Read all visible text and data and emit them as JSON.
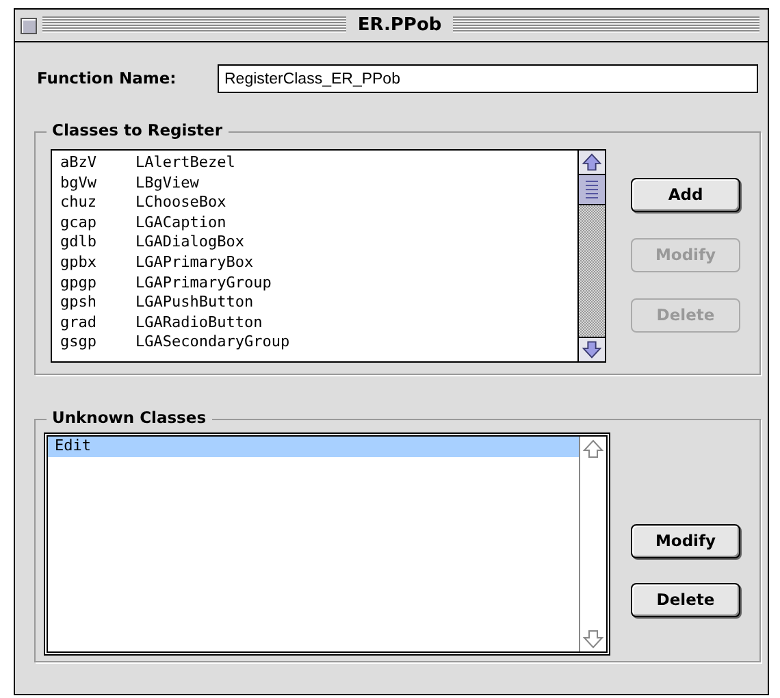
{
  "window": {
    "title": "ER.PPob"
  },
  "function_name": {
    "label": "Function Name:",
    "value": "RegisterClass_ER_PPob"
  },
  "classes_to_register": {
    "title": "Classes to Register",
    "rows": [
      {
        "code": "aBzV",
        "name": "LAlertBezel"
      },
      {
        "code": "bgVw",
        "name": "LBgView"
      },
      {
        "code": "chuz",
        "name": "LChooseBox"
      },
      {
        "code": "gcap",
        "name": "LGACaption"
      },
      {
        "code": "gdlb",
        "name": "LGADialogBox"
      },
      {
        "code": "gpbx",
        "name": "LGAPrimaryBox"
      },
      {
        "code": "gpgp",
        "name": "LGAPrimaryGroup"
      },
      {
        "code": "gpsh",
        "name": "LGAPushButton"
      },
      {
        "code": "grad",
        "name": "LGARadioButton"
      },
      {
        "code": "gsgp",
        "name": "LGASecondaryGroup"
      }
    ],
    "buttons": [
      {
        "label": "Add",
        "disabled": false
      },
      {
        "label": "Modify",
        "disabled": true
      },
      {
        "label": "Delete",
        "disabled": true
      }
    ]
  },
  "unknown_classes": {
    "title": "Unknown Classes",
    "rows": [
      {
        "label": "Edit",
        "selected": true
      }
    ],
    "buttons": [
      {
        "label": "Modify",
        "disabled": false
      },
      {
        "label": "Delete",
        "disabled": false
      }
    ]
  }
}
